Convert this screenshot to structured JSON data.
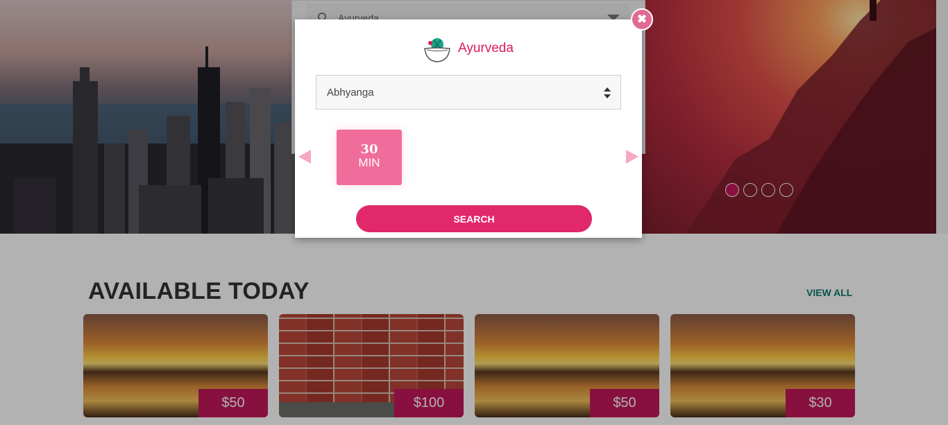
{
  "background_search": {
    "value": "Ayurveda"
  },
  "carousel": {
    "dots": 4,
    "active": 0
  },
  "section": {
    "title": "AVAILABLE TODAY",
    "view_all": "VIEW ALL"
  },
  "cards": [
    {
      "price": "$50"
    },
    {
      "price": "$100"
    },
    {
      "price": "$50"
    },
    {
      "price": "$30"
    }
  ],
  "modal": {
    "brand": "Ayurveda",
    "treatment_select": "Abhyanga",
    "duration": {
      "number": "30",
      "unit": "MIN"
    },
    "search_label": "SEARCH"
  },
  "colors": {
    "accent": "#e0286a",
    "price_bg": "#c2185b",
    "view_all": "#0c7a6a",
    "duration_tile": "#f06c9b"
  }
}
